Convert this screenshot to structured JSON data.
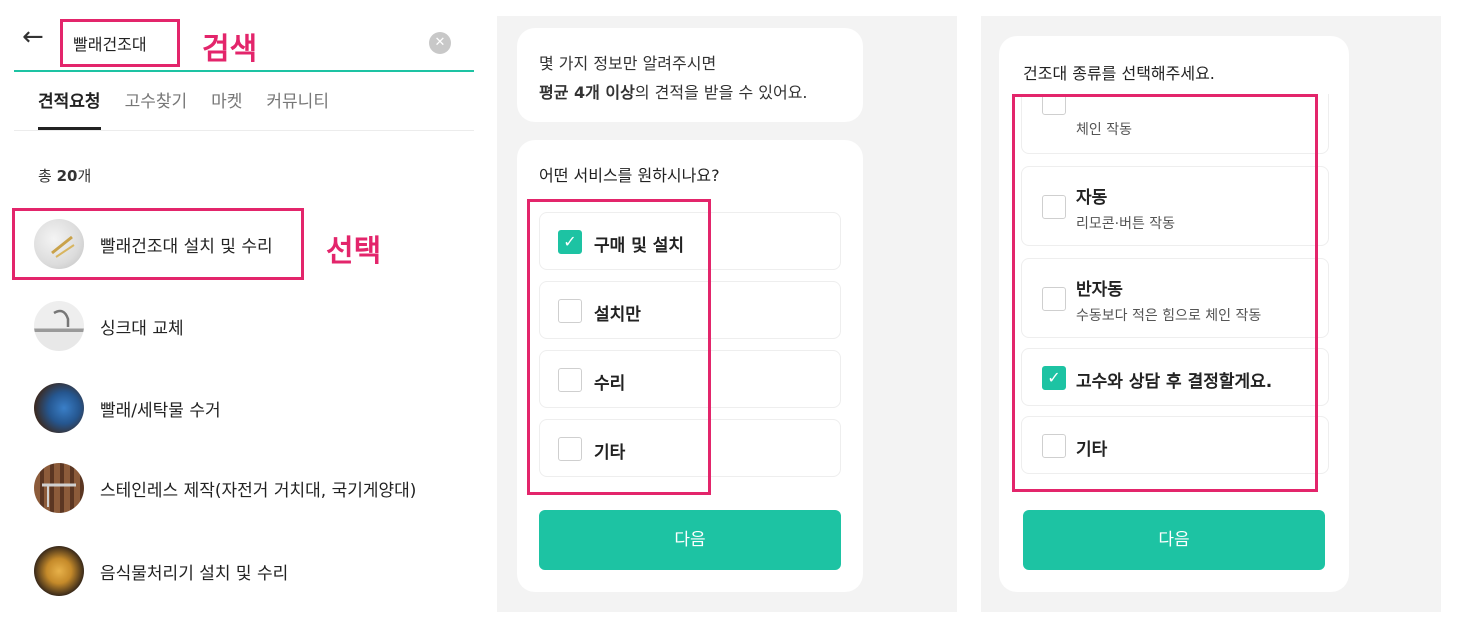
{
  "search_panel": {
    "query": "빨래건조대",
    "annotation_search": "검색",
    "annotation_select": "선택",
    "tabs": [
      "견적요청",
      "고수찾기",
      "마켓",
      "커뮤니티"
    ],
    "count_prefix": "총 ",
    "count_value": "20",
    "count_suffix": "개",
    "results": [
      {
        "label": "빨래건조대 설치 및 수리",
        "icon": "laundry-rack-thumbnail"
      },
      {
        "label": "싱크대 교체",
        "icon": "sink-thumbnail"
      },
      {
        "label": "빨래/세탁물 수거",
        "icon": "laundry-pickup-thumbnail"
      },
      {
        "label": "스테인레스 제작(자전거 거치대, 국기게양대)",
        "icon": "stainless-thumbnail"
      },
      {
        "label": "음식물처리기 설치 및 수리",
        "icon": "food-disposer-thumbnail"
      }
    ]
  },
  "service_panel": {
    "intro_line1": "몇 가지 정보만 알려주시면",
    "intro_bold": "평균 4개 이상",
    "intro_rest": "의 견적을 받을 수 있어요.",
    "question": "어떤 서비스를 원하시나요?",
    "options": [
      {
        "label": "구매 및 설치",
        "checked": true
      },
      {
        "label": "설치만",
        "checked": false
      },
      {
        "label": "수리",
        "checked": false
      },
      {
        "label": "기타",
        "checked": false
      }
    ],
    "next_label": "다음"
  },
  "type_panel": {
    "question": "건조대 종류를 선택해주세요.",
    "options": [
      {
        "title": "",
        "subtitle": "체인 작동",
        "checked": false
      },
      {
        "title": "자동",
        "subtitle": "리모콘·버튼 작동",
        "checked": false
      },
      {
        "title": "반자동",
        "subtitle": "수동보다 적은 힘으로 체인 작동",
        "checked": false
      },
      {
        "title": "고수와 상담 후 결정할게요.",
        "subtitle": "",
        "checked": true
      },
      {
        "title": "기타",
        "subtitle": "",
        "checked": false
      }
    ],
    "next_label": "다음"
  },
  "colors": {
    "accent": "#1dc3a3",
    "annotation": "#e3256b"
  }
}
